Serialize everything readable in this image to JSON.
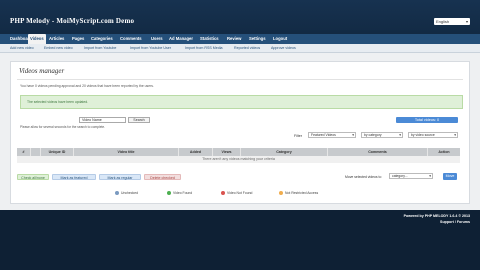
{
  "header": {
    "site_title": "PHP Melody - MoiMyScript.com Demo",
    "language": "English"
  },
  "main_nav": [
    "Dashboard",
    "Videos",
    "Articles",
    "Pages",
    "Categories",
    "Comments",
    "Users",
    "Ad Manager",
    "Statistics",
    "Review",
    "Settings",
    "Logout"
  ],
  "sub_nav": [
    "Add new video",
    "Embed new video",
    "Import from Youtube",
    "Import from Youtube User",
    "Import from RSS Media",
    "Reported videos",
    "Approve videos"
  ],
  "page": {
    "title": "Videos manager",
    "description": "You have 0 videos pending approval and 20 videos that have been reported by the users.",
    "notice": "The selected videos have been updated."
  },
  "search": {
    "select_value": "Video Name",
    "button": "Search",
    "note": "Please allow for several seconds for the search to complete."
  },
  "total_badge": "Total videos: 0",
  "filter": {
    "label": "Filter",
    "featured": "Featured Videos",
    "category": "by category",
    "views": "by video source"
  },
  "table": {
    "headers": [
      "#",
      "",
      "Unique ID",
      "Video title",
      "Added",
      "Views",
      "Category",
      "Comments",
      "Action"
    ],
    "empty_message": "There aren't any videos matching your criteria"
  },
  "actions": {
    "check_all": "Check all/none",
    "featured": "Mark as featured",
    "regular": "Mark as regular",
    "delete": "Delete checked",
    "bulk_label": "Move selected videos to",
    "bulk_select": "category...",
    "apply": "Move"
  },
  "legend": [
    {
      "label": "Unchecked",
      "color": "#7a9ac0"
    },
    {
      "label": "Video Found",
      "color": "#4caf50"
    },
    {
      "label": "Video Not Found",
      "color": "#d9534f"
    },
    {
      "label": "Not Restricted Access",
      "color": "#f0ad4e"
    }
  ],
  "footer": {
    "powered": "Powered by PHP MELODY 1.6.4 © 2013",
    "support": "Support / Forums"
  },
  "colors": {
    "nav_blue": "#25507a",
    "dark_bg": "#0e2034",
    "accent": "#4b8ad6"
  }
}
